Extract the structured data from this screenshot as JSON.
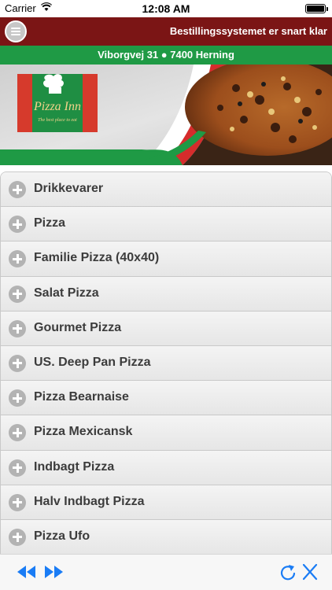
{
  "status_bar": {
    "carrier": "Carrier",
    "time": "12:08 AM"
  },
  "header": {
    "title": "Bestillingssystemet er snart klar"
  },
  "address_bar": {
    "text": "Viborgvej 31 ● 7400 Herning"
  },
  "banner": {
    "logo_text": "Pizza Inn",
    "logo_tagline": "The best place to eat"
  },
  "categories": [
    {
      "label": "Drikkevarer"
    },
    {
      "label": "Pizza"
    },
    {
      "label": "Familie Pizza (40x40)"
    },
    {
      "label": "Salat Pizza"
    },
    {
      "label": "Gourmet Pizza"
    },
    {
      "label": "US. Deep Pan Pizza"
    },
    {
      "label": "Pizza Bearnaise"
    },
    {
      "label": "Pizza Mexicansk"
    },
    {
      "label": "Indbagt Pizza"
    },
    {
      "label": "Halv Indbagt Pizza"
    },
    {
      "label": "Pizza Ufo"
    }
  ],
  "toolbar": {
    "icons": [
      "rewind-icon",
      "fast-forward-icon",
      "refresh-icon",
      "close-icon"
    ]
  },
  "colors": {
    "header": "#7b1515",
    "address_bar": "#1f9a45",
    "toolbar_icon": "#1a7cf5"
  }
}
